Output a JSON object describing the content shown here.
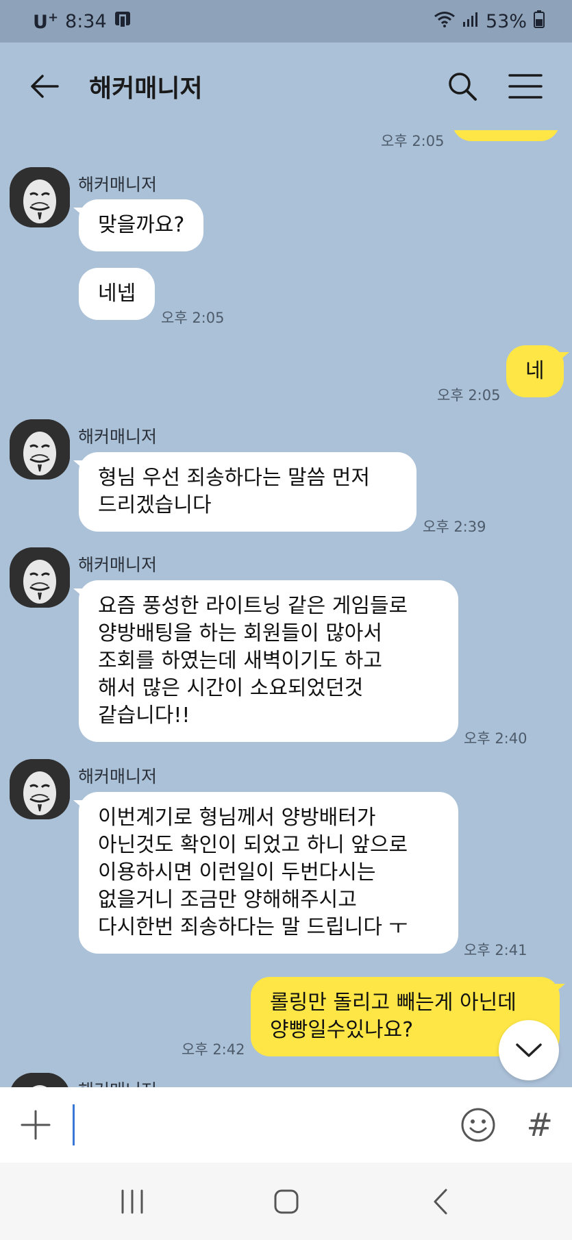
{
  "status_bar": {
    "carrier": "U",
    "carrier_sup": "+",
    "time": "8:34",
    "battery": "53%"
  },
  "header": {
    "title": "해커매니저"
  },
  "messages": [
    {
      "time": "오후 2:05"
    },
    {
      "sender": "해커매니저",
      "text": "맞을까요?"
    },
    {
      "text": "네넵",
      "time": "오후 2:05"
    },
    {
      "text": "네",
      "time": "오후 2:05"
    },
    {
      "sender": "해커매니저",
      "text": "형님 우선 죄송하다는 말씀 먼저\n드리겠습니다",
      "time": "오후 2:39"
    },
    {
      "sender": "해커매니저",
      "text": "요즘 풍성한 라이트닝 같은 게임들로\n양방배팅을 하는 회원들이 많아서\n조회를 하였는데 새벽이기도 하고\n해서 많은 시간이 소요되었던것\n같습니다!!",
      "time": "오후 2:40"
    },
    {
      "sender": "해커매니저",
      "text": "이번계기로 형님께서 양방배터가\n아닌것도 확인이 되었고 하니 앞으로\n이용하시면 이런일이 두번다시는\n없을거니 조금만 양해해주시고\n다시한번 죄송하다는 말 드립니다 ㅜ",
      "time": "오후 2:41"
    },
    {
      "text": "롤링만 돌리고 빼는게 아닌데\n양빵일수있나요?",
      "time": "오후 2:42"
    },
    {
      "sender": "해커매니저"
    }
  ],
  "input": {
    "placeholder": ""
  },
  "icons": {
    "back": "arrow-left-icon",
    "search": "search-icon",
    "menu": "hamburger-menu-icon",
    "plus": "plus-icon",
    "emoji": "smiley-icon",
    "hash": "#"
  },
  "colors": {
    "chat_background": "#abc1d8",
    "my_bubble": "#fde646",
    "other_bubble": "#ffffff"
  }
}
